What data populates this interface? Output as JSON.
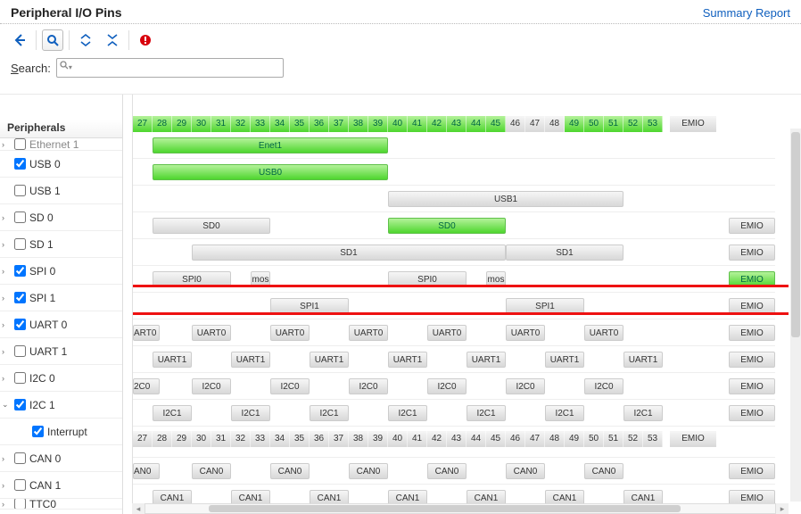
{
  "header": {
    "title": "Peripheral I/O Pins",
    "summary_link": "Summary Report"
  },
  "search": {
    "label_html": "Search:"
  },
  "sidebar": {
    "title": "Peripherals",
    "items": [
      {
        "name": "Ethernet 1",
        "checked": false,
        "expandable": true,
        "indent": false,
        "partial": true
      },
      {
        "name": "USB 0",
        "checked": true,
        "expandable": false,
        "indent": false
      },
      {
        "name": "USB 1",
        "checked": false,
        "expandable": false,
        "indent": false
      },
      {
        "name": "SD 0",
        "checked": false,
        "expandable": true,
        "indent": false
      },
      {
        "name": "SD 1",
        "checked": false,
        "expandable": true,
        "indent": false
      },
      {
        "name": "SPI 0",
        "checked": true,
        "expandable": true,
        "indent": false,
        "highlight": true
      },
      {
        "name": "SPI 1",
        "checked": true,
        "expandable": true,
        "indent": false
      },
      {
        "name": "UART 0",
        "checked": true,
        "expandable": true,
        "indent": false
      },
      {
        "name": "UART 1",
        "checked": false,
        "expandable": true,
        "indent": false
      },
      {
        "name": "I2C 0",
        "checked": false,
        "expandable": true,
        "indent": false
      },
      {
        "name": "I2C 1",
        "checked": true,
        "expandable": true,
        "indent": false,
        "expanded": true
      },
      {
        "name": "Interrupt",
        "checked": true,
        "expandable": false,
        "indent": true
      },
      {
        "name": "CAN 0",
        "checked": false,
        "expandable": true,
        "indent": false
      },
      {
        "name": "CAN 1",
        "checked": false,
        "expandable": true,
        "indent": false
      },
      {
        "name": "TTC0",
        "checked": false,
        "expandable": true,
        "indent": false,
        "partial_bottom": true
      }
    ]
  },
  "pins": {
    "start": 27,
    "end": 53,
    "green_ranges": [
      [
        27,
        39
      ],
      [
        40,
        45
      ],
      [
        49,
        53
      ]
    ],
    "emio_label": "EMIO"
  },
  "rows": [
    {
      "peripheral": "Ethernet 1",
      "cells": [
        {
          "label": "Enet1",
          "start": 28,
          "end": 39,
          "color": "green"
        }
      ]
    },
    {
      "peripheral": "USB 0",
      "cells": [
        {
          "label": "USB0",
          "start": 28,
          "end": 39,
          "color": "green"
        }
      ]
    },
    {
      "peripheral": "USB 1",
      "cells": [
        {
          "label": "USB1",
          "start": 40,
          "end": 51,
          "color": "gray"
        }
      ]
    },
    {
      "peripheral": "SD 0",
      "cells": [
        {
          "label": "SD0",
          "start": 28,
          "end": 33,
          "color": "gray"
        },
        {
          "label": "SD0",
          "start": 40,
          "end": 45,
          "color": "green"
        },
        {
          "label": "EMIO",
          "emio": true,
          "color": "gray"
        }
      ]
    },
    {
      "peripheral": "SD 1",
      "cells": [
        {
          "label": "SD1",
          "start": 30,
          "end": 45,
          "color": "gray"
        },
        {
          "label": "SD1",
          "start": 46,
          "end": 51,
          "color": "gray"
        },
        {
          "label": "EMIO",
          "emio": true,
          "color": "gray"
        }
      ]
    },
    {
      "peripheral": "SPI 0",
      "highlight": true,
      "cells": [
        {
          "label": "SPI0",
          "start": 28,
          "end": 31,
          "color": "gray"
        },
        {
          "label": "mos",
          "start": 33,
          "end": 33,
          "color": "gray"
        },
        {
          "label": "SPI0",
          "start": 40,
          "end": 43,
          "color": "gray"
        },
        {
          "label": "mos",
          "start": 45,
          "end": 45,
          "color": "gray"
        },
        {
          "label": "EMIO",
          "emio": true,
          "color": "green"
        }
      ]
    },
    {
      "peripheral": "SPI 1",
      "cells": [
        {
          "label": "SPI1",
          "start": 34,
          "end": 37,
          "color": "gray"
        },
        {
          "label": "SPI1",
          "start": 46,
          "end": 49,
          "color": "gray"
        },
        {
          "label": "EMIO",
          "emio": true,
          "color": "gray"
        }
      ]
    },
    {
      "peripheral": "UART 0",
      "cells": [
        {
          "label": "ART0",
          "start": 27,
          "end": 27,
          "color": "gray",
          "partial_left": true
        },
        {
          "label": "UART0",
          "start": 30,
          "end": 31,
          "color": "gray"
        },
        {
          "label": "UART0",
          "start": 34,
          "end": 35,
          "color": "gray"
        },
        {
          "label": "UART0",
          "start": 38,
          "end": 39,
          "color": "gray"
        },
        {
          "label": "UART0",
          "start": 42,
          "end": 43,
          "color": "gray"
        },
        {
          "label": "UART0",
          "start": 46,
          "end": 47,
          "color": "gray"
        },
        {
          "label": "UART0",
          "start": 50,
          "end": 51,
          "color": "gray"
        },
        {
          "label": "EMIO",
          "emio": true,
          "color": "gray"
        }
      ]
    },
    {
      "peripheral": "UART 1",
      "cells": [
        {
          "label": "UART1",
          "start": 28,
          "end": 29,
          "color": "gray"
        },
        {
          "label": "UART1",
          "start": 32,
          "end": 33,
          "color": "gray"
        },
        {
          "label": "UART1",
          "start": 36,
          "end": 37,
          "color": "gray"
        },
        {
          "label": "UART1",
          "start": 40,
          "end": 41,
          "color": "gray"
        },
        {
          "label": "UART1",
          "start": 44,
          "end": 45,
          "color": "gray"
        },
        {
          "label": "UART1",
          "start": 48,
          "end": 49,
          "color": "gray"
        },
        {
          "label": "UART1",
          "start": 52,
          "end": 53,
          "color": "gray"
        },
        {
          "label": "EMIO",
          "emio": true,
          "color": "gray"
        }
      ]
    },
    {
      "peripheral": "I2C 0",
      "cells": [
        {
          "label": "2C0",
          "start": 27,
          "end": 27,
          "color": "gray",
          "partial_left": true
        },
        {
          "label": "I2C0",
          "start": 30,
          "end": 31,
          "color": "gray"
        },
        {
          "label": "I2C0",
          "start": 34,
          "end": 35,
          "color": "gray"
        },
        {
          "label": "I2C0",
          "start": 38,
          "end": 39,
          "color": "gray"
        },
        {
          "label": "I2C0",
          "start": 42,
          "end": 43,
          "color": "gray"
        },
        {
          "label": "I2C0",
          "start": 46,
          "end": 47,
          "color": "gray"
        },
        {
          "label": "I2C0",
          "start": 50,
          "end": 51,
          "color": "gray"
        },
        {
          "label": "EMIO",
          "emio": true,
          "color": "gray"
        }
      ]
    },
    {
      "peripheral": "I2C 1",
      "cells": [
        {
          "label": "I2C1",
          "start": 28,
          "end": 29,
          "color": "gray"
        },
        {
          "label": "I2C1",
          "start": 32,
          "end": 33,
          "color": "gray"
        },
        {
          "label": "I2C1",
          "start": 36,
          "end": 37,
          "color": "gray"
        },
        {
          "label": "I2C1",
          "start": 40,
          "end": 41,
          "color": "gray"
        },
        {
          "label": "I2C1",
          "start": 44,
          "end": 45,
          "color": "gray"
        },
        {
          "label": "I2C1",
          "start": 48,
          "end": 49,
          "color": "gray"
        },
        {
          "label": "I2C1",
          "start": 52,
          "end": 53,
          "color": "gray"
        },
        {
          "label": "EMIO",
          "emio": true,
          "color": "gray"
        }
      ]
    },
    {
      "peripheral": "Interrupt",
      "pins_repeat": true
    },
    {
      "peripheral": "CAN 0",
      "cells": [
        {
          "label": "AN0",
          "start": 27,
          "end": 27,
          "color": "gray",
          "partial_left": true
        },
        {
          "label": "CAN0",
          "start": 30,
          "end": 31,
          "color": "gray"
        },
        {
          "label": "CAN0",
          "start": 34,
          "end": 35,
          "color": "gray"
        },
        {
          "label": "CAN0",
          "start": 38,
          "end": 39,
          "color": "gray"
        },
        {
          "label": "CAN0",
          "start": 42,
          "end": 43,
          "color": "gray"
        },
        {
          "label": "CAN0",
          "start": 46,
          "end": 47,
          "color": "gray"
        },
        {
          "label": "CAN0",
          "start": 50,
          "end": 51,
          "color": "gray"
        },
        {
          "label": "EMIO",
          "emio": true,
          "color": "gray"
        }
      ]
    },
    {
      "peripheral": "CAN 1",
      "cells": [
        {
          "label": "CAN1",
          "start": 28,
          "end": 29,
          "color": "gray"
        },
        {
          "label": "CAN1",
          "start": 32,
          "end": 33,
          "color": "gray"
        },
        {
          "label": "CAN1",
          "start": 36,
          "end": 37,
          "color": "gray"
        },
        {
          "label": "CAN1",
          "start": 40,
          "end": 41,
          "color": "gray"
        },
        {
          "label": "CAN1",
          "start": 44,
          "end": 45,
          "color": "gray"
        },
        {
          "label": "CAN1",
          "start": 48,
          "end": 49,
          "color": "gray"
        },
        {
          "label": "CAN1",
          "start": 52,
          "end": 53,
          "color": "gray"
        },
        {
          "label": "EMIO",
          "emio": true,
          "color": "gray"
        }
      ]
    }
  ]
}
